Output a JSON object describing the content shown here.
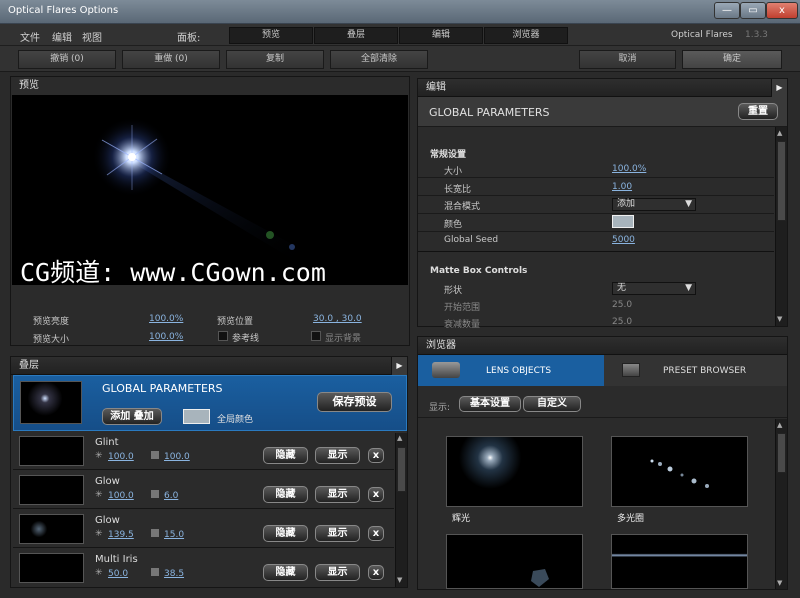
{
  "window": {
    "title": "Optical Flares Options",
    "min": "—",
    "max": "▭",
    "close": "x"
  },
  "menu": {
    "file": "文件",
    "edit": "编辑",
    "view": "视图",
    "panel": "面板:",
    "tabs": [
      "预览",
      "叠层",
      "编辑",
      "浏览器"
    ],
    "brand": "Optical Flares",
    "version": "1.3.3"
  },
  "toolbar": {
    "undo": "撤销 (0)",
    "redo": "重做 (0)",
    "copy": "复制",
    "clear_all": "全部清除",
    "cancel": "取消",
    "ok": "确定"
  },
  "preview": {
    "title": "预览",
    "watermark": "CG频道: www.CGown.com",
    "brightness_label": "预览亮度",
    "brightness": "100.0%",
    "size_label": "预览大小",
    "size": "100.0%",
    "position_label": "预览位置",
    "position": "30.0 , 30.0",
    "reference_label": "参考线",
    "show_bg_label": "显示背景"
  },
  "editor": {
    "title": "编辑",
    "param_title": "GLOBAL PARAMETERS",
    "reset": "重置",
    "general_header": "常规设置",
    "rows": [
      {
        "label": "大小",
        "value": "100.0%"
      },
      {
        "label": "长宽比",
        "value": "1.00"
      },
      {
        "label": "混合模式",
        "value": "添加"
      },
      {
        "label": "颜色",
        "value": ""
      },
      {
        "label": "Global Seed",
        "value": "5000"
      }
    ],
    "matte_header": "Matte Box Controls",
    "matte_rows": [
      {
        "label": "形状",
        "value": "无"
      },
      {
        "label": "开始范围",
        "value": "25.0"
      },
      {
        "label": "衰减数量",
        "value": "25.0"
      }
    ]
  },
  "layers": {
    "title": "叠层",
    "global": {
      "name": "GLOBAL PARAMETERS",
      "blend": "添加 叠加",
      "color_label": "全局颜色",
      "save": "保存预设"
    },
    "items": [
      {
        "name": "Glint",
        "brightness": "100.0",
        "scale": "100.0"
      },
      {
        "name": "Glow",
        "brightness": "100.0",
        "scale": "6.0"
      },
      {
        "name": "Glow",
        "brightness": "139.5",
        "scale": "15.0"
      },
      {
        "name": "Multi Iris",
        "brightness": "50.0",
        "scale": "38.5"
      }
    ],
    "hide": "隐藏",
    "show": "显示",
    "remove": "x"
  },
  "browser": {
    "title": "浏览器",
    "lens_objects": "LENS OBJECTS",
    "preset_browser": "PRESET BROWSER",
    "display_label": "显示:",
    "basic": "基本设置",
    "custom": "自定义",
    "items": [
      "辉光",
      "多光圈"
    ]
  }
}
